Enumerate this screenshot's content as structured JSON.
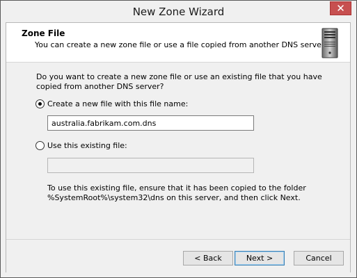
{
  "window": {
    "title": "New Zone Wizard",
    "close_label": "✕"
  },
  "header": {
    "title": "Zone File",
    "subtitle": "You can create a new zone file or use a file copied from another DNS server."
  },
  "body": {
    "question": "Do you want to create a new zone file or use an existing file that you have copied from another DNS server?",
    "option_new_label": "Create a new file with this file name:",
    "option_new_selected": true,
    "new_file_value": "australia.fabrikam.com.dns",
    "option_existing_label": "Use this existing file:",
    "option_existing_selected": false,
    "existing_file_value": "",
    "note": "To use this existing file, ensure that it has been copied to the folder %SystemRoot%\\system32\\dns on this server, and then click Next."
  },
  "buttons": {
    "back": "< Back",
    "next": "Next >",
    "cancel": "Cancel"
  },
  "icons": {
    "header_icon": "server-icon"
  }
}
